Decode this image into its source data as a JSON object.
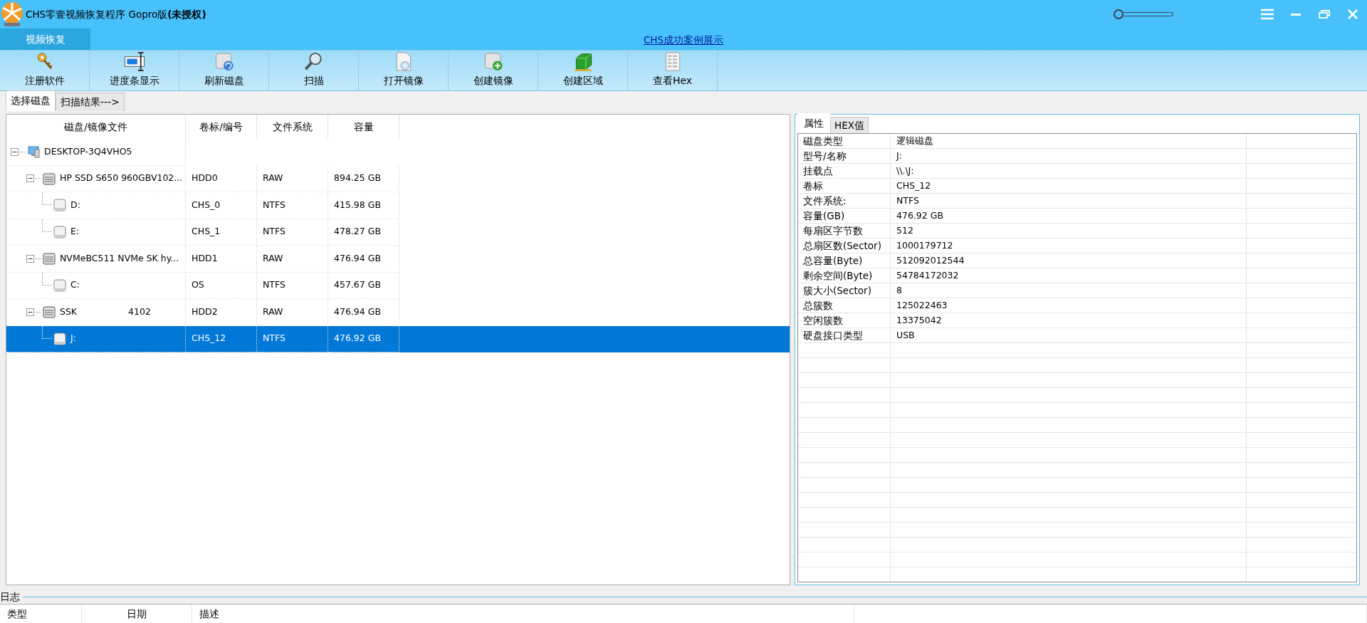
{
  "window": {
    "title": "CHS零壹视频恢复程序 Gopro版**(未授权)**",
    "opacity_slider": {
      "level": 0
    }
  },
  "menu_tabs": [
    {
      "label": "视频恢复",
      "selected": true
    }
  ],
  "link": "CHS成功案例展示",
  "toolbar": [
    "注册软件",
    "进度条显示",
    "刷新磁盘",
    "扫描",
    "打开镜像",
    "创建镜像",
    "创建区域",
    "查看Hex"
  ],
  "tabs": [
    {
      "label": "选择磁盘",
      "selected": true
    },
    {
      "label": "扫描结果--->",
      "selected": false
    }
  ],
  "tree": {
    "columns": [
      "磁盘/镜像文件",
      "卷标/编号",
      "文件系统",
      "容量"
    ],
    "rows": [
      {
        "kind": "computer",
        "name": "DESKTOP-3Q4VHO5",
        "expanded": true,
        "selected": false,
        "children": [
          {
            "kind": "disk",
            "name": "HP SSD S650 960GBV102...",
            "label": "HDD0",
            "fs": "RAW",
            "size": "894.25 GB",
            "expanded": true,
            "selected": false,
            "children": [
              {
                "kind": "partition",
                "name": "D:",
                "label": "CHS_0",
                "fs": "NTFS",
                "size": "415.98 GB",
                "selected": false
              },
              {
                "kind": "partition",
                "name": "E:",
                "label": "CHS_1",
                "fs": "NTFS",
                "size": "478.27 GB",
                "selected": false
              }
            ]
          },
          {
            "kind": "disk",
            "name": "NVMeBC511 NVMe SK hy...",
            "label": "HDD1",
            "fs": "RAW",
            "size": "476.94 GB",
            "expanded": true,
            "selected": false,
            "children": [
              {
                "kind": "partition",
                "name": "C:",
                "label": "OS",
                "fs": "NTFS",
                "size": "457.67 GB",
                "selected": false
              }
            ]
          },
          {
            "kind": "disk",
            "name": "SSK",
            "name_suffix": "4102",
            "label": "HDD2",
            "fs": "RAW",
            "size": "476.94 GB",
            "expanded": true,
            "selected": false,
            "children": [
              {
                "kind": "partition",
                "name": "J:",
                "label": "CHS_12",
                "fs": "NTFS",
                "size": "476.92 GB",
                "selected": true
              }
            ]
          }
        ]
      }
    ]
  },
  "side_tabs": [
    {
      "label": "属性",
      "selected": true
    },
    {
      "label": "HEX值",
      "selected": false
    }
  ],
  "properties": [
    {
      "key": "磁盘类型",
      "value": "逻辑磁盘"
    },
    {
      "key": "型号/名称",
      "value": "J:"
    },
    {
      "key": "挂载点",
      "value": "\\\\.\\J:"
    },
    {
      "key": "卷标",
      "value": "CHS_12"
    },
    {
      "key": "文件系统:",
      "value": "NTFS"
    },
    {
      "key": "容量(GB)",
      "value": "476.92 GB"
    },
    {
      "key": "每扇区字节数",
      "value": "512"
    },
    {
      "key": "总扇区数(Sector)",
      "value": "1000179712"
    },
    {
      "key": "总容量(Byte)",
      "value": "512092012544"
    },
    {
      "key": "剩余空间(Byte)",
      "value": "54784172032"
    },
    {
      "key": "簇大小(Sector)",
      "value": "8"
    },
    {
      "key": "总簇数",
      "value": "125022463"
    },
    {
      "key": "空闲簇数",
      "value": "13375042"
    },
    {
      "key": "硬盘接口类型",
      "value": "USB"
    }
  ],
  "log": {
    "title": "日志",
    "columns": [
      "类型",
      "日期",
      "描述"
    ]
  }
}
